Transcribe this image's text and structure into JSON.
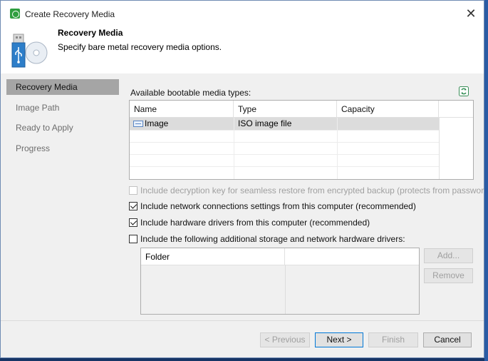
{
  "window": {
    "title": "Create Recovery Media"
  },
  "header": {
    "title": "Recovery Media",
    "subtitle": "Specify bare metal recovery media options."
  },
  "steps": [
    {
      "label": "Recovery Media",
      "active": true
    },
    {
      "label": "Image Path",
      "active": false
    },
    {
      "label": "Ready to Apply",
      "active": false
    },
    {
      "label": "Progress",
      "active": false
    }
  ],
  "media": {
    "label": "Available bootable media types:",
    "columns": [
      "Name",
      "Type",
      "Capacity"
    ],
    "rows": [
      {
        "name": "Image",
        "type": "ISO image file",
        "capacity": ""
      }
    ]
  },
  "options": {
    "decryption_key": {
      "label": "Include decryption key for seamless restore from encrypted backup (protects from password loss)",
      "checked": false,
      "disabled": true
    },
    "network_settings": {
      "label": "Include network connections settings from this computer (recommended)",
      "checked": true,
      "disabled": false
    },
    "hardware_drivers": {
      "label": "Include hardware drivers from this computer (recommended)",
      "checked": true,
      "disabled": false
    },
    "additional_drivers": {
      "label": "Include the following additional storage and network hardware drivers:",
      "checked": false,
      "disabled": false
    }
  },
  "folders": {
    "columns": [
      "Folder"
    ],
    "add_label": "Add...",
    "remove_label": "Remove"
  },
  "footer": {
    "previous_label": "< Previous",
    "next_label": "Next >",
    "finish_label": "Finish",
    "cancel_label": "Cancel"
  },
  "colors": {
    "accent": "#0078d7",
    "active_step": "#a5a5a5",
    "selected_row": "#dcdcdc",
    "app_icon": "#2f9e3f"
  }
}
